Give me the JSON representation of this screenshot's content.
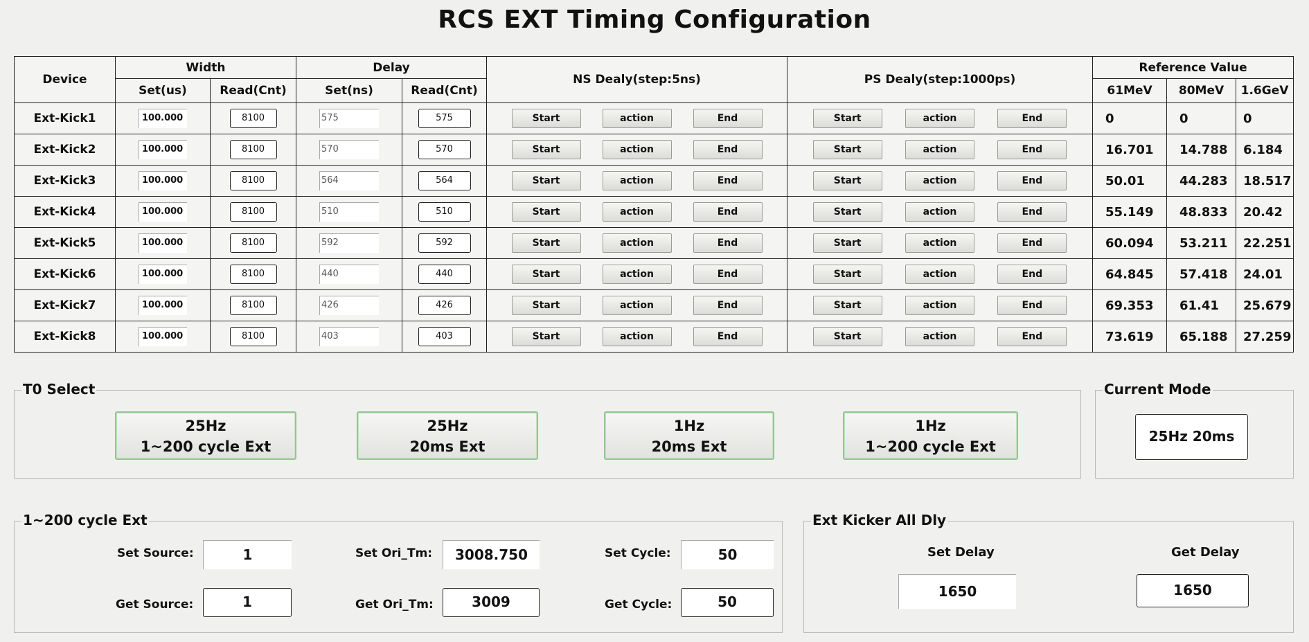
{
  "title": "RCS EXT Timing Configuration",
  "table": {
    "headers": {
      "device": "Device",
      "width": "Width",
      "delay": "Delay",
      "ns_delay": "NS Dealy(step:5ns)",
      "ps_delay": "PS Dealy(step:1000ps)",
      "reference": "Reference  Value",
      "width_set": "Set(us)",
      "width_read": "Read(Cnt)",
      "delay_set": "Set(ns)",
      "delay_read": "Read(Cnt)",
      "ref_61": "61MeV",
      "ref_80": "80MeV",
      "ref_16": "1.6GeV"
    },
    "button_labels": {
      "start": "Start",
      "action": "action",
      "end": "End"
    },
    "rows": [
      {
        "device": "Ext-Kick1",
        "width_set": "100.000",
        "width_read": "8100",
        "delay_set": "575",
        "delay_read": "575",
        "ref_61": "0",
        "ref_80": "0",
        "ref_16": "0"
      },
      {
        "device": "Ext-Kick2",
        "width_set": "100.000",
        "width_read": "8100",
        "delay_set": "570",
        "delay_read": "570",
        "ref_61": "16.701",
        "ref_80": "14.788",
        "ref_16": "6.184"
      },
      {
        "device": "Ext-Kick3",
        "width_set": "100.000",
        "width_read": "8100",
        "delay_set": "564",
        "delay_read": "564",
        "ref_61": "50.01",
        "ref_80": "44.283",
        "ref_16": "18.517"
      },
      {
        "device": "Ext-Kick4",
        "width_set": "100.000",
        "width_read": "8100",
        "delay_set": "510",
        "delay_read": "510",
        "ref_61": "55.149",
        "ref_80": "48.833",
        "ref_16": "20.42"
      },
      {
        "device": "Ext-Kick5",
        "width_set": "100.000",
        "width_read": "8100",
        "delay_set": "592",
        "delay_read": "592",
        "ref_61": "60.094",
        "ref_80": "53.211",
        "ref_16": "22.251"
      },
      {
        "device": "Ext-Kick6",
        "width_set": "100.000",
        "width_read": "8100",
        "delay_set": "440",
        "delay_read": "440",
        "ref_61": "64.845",
        "ref_80": "57.418",
        "ref_16": "24.01"
      },
      {
        "device": "Ext-Kick7",
        "width_set": "100.000",
        "width_read": "8100",
        "delay_set": "426",
        "delay_read": "426",
        "ref_61": "69.353",
        "ref_80": "61.41",
        "ref_16": "25.679"
      },
      {
        "device": "Ext-Kick8",
        "width_set": "100.000",
        "width_read": "8100",
        "delay_set": "403",
        "delay_read": "403",
        "ref_61": "73.619",
        "ref_80": "65.188",
        "ref_16": "27.259"
      }
    ]
  },
  "t0_select": {
    "title": "T0 Select",
    "buttons": [
      {
        "line1": "25Hz",
        "line2": "1~200  cycle Ext"
      },
      {
        "line1": "25Hz",
        "line2": "20ms Ext"
      },
      {
        "line1": "1Hz",
        "line2": "20ms Ext"
      },
      {
        "line1": "1Hz",
        "line2": "1~200  cycle Ext"
      }
    ]
  },
  "current_mode": {
    "title": "Current Mode",
    "value": "25Hz 20ms"
  },
  "cycle_ext": {
    "title": "1~200 cycle Ext",
    "set_source_label": "Set Source:",
    "set_source_value": "1",
    "get_source_label": "Get Source:",
    "get_source_value": "1",
    "set_ori_label": "Set Ori_Tm:",
    "set_ori_value": "3008.750",
    "get_ori_label": "Get Ori_Tm:",
    "get_ori_value": "3009",
    "set_cycle_label": "Set Cycle:",
    "set_cycle_value": "50",
    "get_cycle_label": "Get Cycle:",
    "get_cycle_value": "50"
  },
  "kicker_all_dly": {
    "title": "Ext Kicker All Dly",
    "set_label": "Set Delay",
    "set_value": "1650",
    "get_label": "Get Delay",
    "get_value": "1650"
  }
}
